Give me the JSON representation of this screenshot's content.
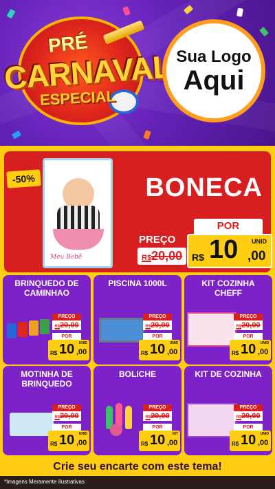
{
  "header": {
    "title_pre": "PRÉ",
    "title_main": "CARNAVAL",
    "title_sub": "ESPECIAL",
    "logo_line1": "Sua Logo",
    "logo_line2": "Aqui"
  },
  "colors": {
    "background": "#5b1e9e",
    "board": "#ffcd12",
    "hero": "#d81f20",
    "card": "#7d22c8",
    "price_tag": "#ffcd12"
  },
  "hero": {
    "discount": "-50%",
    "name": "BONECA",
    "box_label": "Meu Bebê",
    "price_label": "PREÇO",
    "old_currency": "R$",
    "old_price": "20,00",
    "por_label": "POR",
    "currency": "R$",
    "price_int": "10",
    "price_dec": ",00",
    "unit": "UNID"
  },
  "products": [
    {
      "name": "BRINQUEDO DE CAMINHAO",
      "icon": "toy-trucks",
      "price_label": "PREÇO",
      "old_currency": "R$",
      "old_price": "20,00",
      "por_label": "POR",
      "currency": "R$",
      "price_int": "10",
      "price_dec": ",00",
      "unit": "UNID"
    },
    {
      "name": "PISCINA 1000L",
      "icon": "pool",
      "price_label": "PREÇO",
      "old_currency": "R$",
      "old_price": "20,00",
      "por_label": "POR",
      "currency": "R$",
      "price_int": "10",
      "price_dec": ",00",
      "unit": "UNID"
    },
    {
      "name": "KIT COZINHA CHEFF",
      "icon": "kitchen-kit",
      "price_label": "PREÇO",
      "old_currency": "R$",
      "old_price": "20,00",
      "por_label": "POR",
      "currency": "R$",
      "price_int": "10",
      "price_dec": ",00",
      "unit": "UNID"
    },
    {
      "name": "MOTINHA DE BRINQUEDO",
      "icon": "toy-motorbike",
      "price_label": "PREÇO",
      "old_currency": "R$",
      "old_price": "20,00",
      "por_label": "POR",
      "currency": "R$",
      "price_int": "10",
      "price_dec": ",00",
      "unit": "UNID"
    },
    {
      "name": "BOLICHE",
      "icon": "bowling-set",
      "price_label": "PREÇO",
      "old_currency": "R$",
      "old_price": "20,00",
      "por_label": "POR",
      "currency": "R$",
      "price_int": "10",
      "price_dec": ",00",
      "unit": "KIT"
    },
    {
      "name": "KIT DE COZINHA",
      "icon": "kitchen-kit",
      "price_label": "PREÇO",
      "old_currency": "R$",
      "old_price": "20,00",
      "por_label": "POR",
      "currency": "R$",
      "price_int": "10",
      "price_dec": ",00",
      "unit": "UNID"
    }
  ],
  "cta": "Crie seu encarte com este tema!",
  "footer": "*Imagens Meramente Ilustrativas"
}
